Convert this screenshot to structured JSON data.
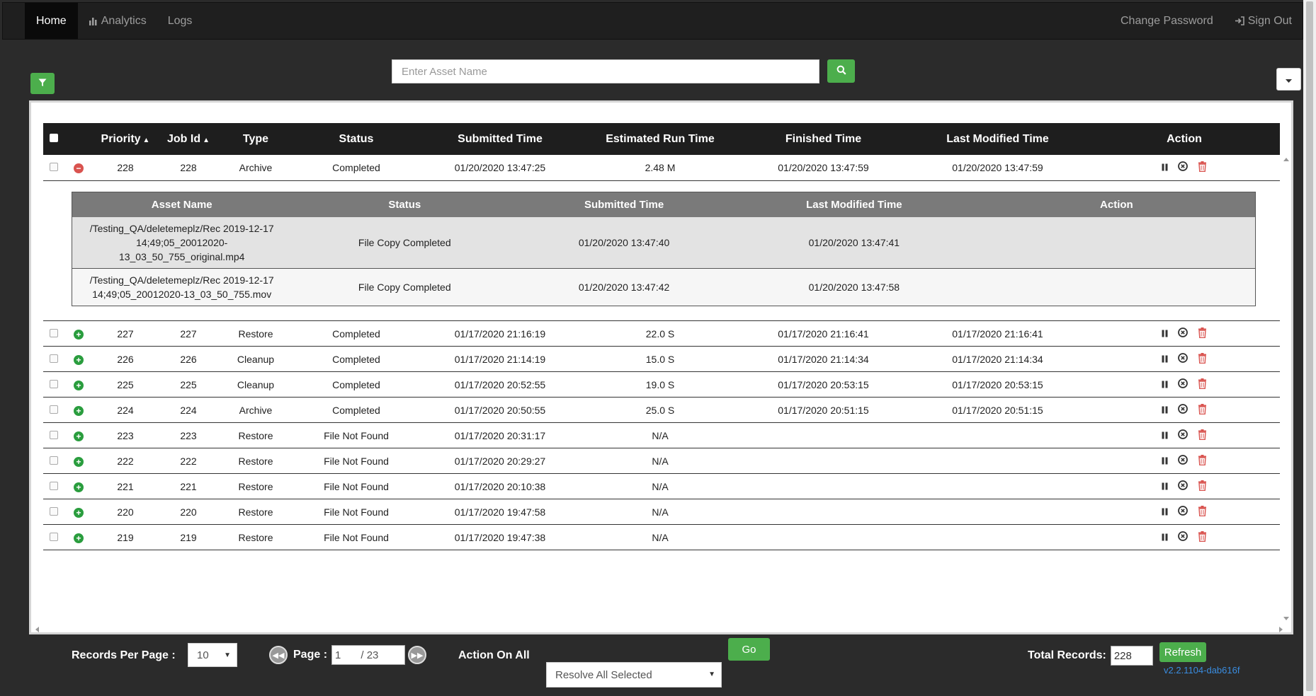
{
  "nav": {
    "home": "Home",
    "analytics": "Analytics",
    "logs": "Logs",
    "change_password": "Change Password",
    "sign_out": "Sign Out"
  },
  "search": {
    "placeholder": "Enter Asset Name"
  },
  "table": {
    "headers": {
      "priority": "Priority",
      "job_id": "Job Id",
      "type": "Type",
      "status": "Status",
      "submitted": "Submitted Time",
      "estimated": "Estimated Run Time",
      "finished": "Finished Time",
      "last_modified": "Last Modified Time",
      "action": "Action"
    },
    "rows": [
      {
        "priority": "228",
        "job_id": "228",
        "type": "Archive",
        "status": "Completed",
        "submitted": "01/20/2020 13:47:25",
        "estimated": "2.48 M",
        "finished": "01/20/2020 13:47:59",
        "last_modified": "01/20/2020 13:47:59",
        "expanded": true
      },
      {
        "priority": "227",
        "job_id": "227",
        "type": "Restore",
        "status": "Completed",
        "submitted": "01/17/2020 21:16:19",
        "estimated": "22.0 S",
        "finished": "01/17/2020 21:16:41",
        "last_modified": "01/17/2020 21:16:41"
      },
      {
        "priority": "226",
        "job_id": "226",
        "type": "Cleanup",
        "status": "Completed",
        "submitted": "01/17/2020 21:14:19",
        "estimated": "15.0 S",
        "finished": "01/17/2020 21:14:34",
        "last_modified": "01/17/2020 21:14:34"
      },
      {
        "priority": "225",
        "job_id": "225",
        "type": "Cleanup",
        "status": "Completed",
        "submitted": "01/17/2020 20:52:55",
        "estimated": "19.0 S",
        "finished": "01/17/2020 20:53:15",
        "last_modified": "01/17/2020 20:53:15"
      },
      {
        "priority": "224",
        "job_id": "224",
        "type": "Archive",
        "status": "Completed",
        "submitted": "01/17/2020 20:50:55",
        "estimated": "25.0 S",
        "finished": "01/17/2020 20:51:15",
        "last_modified": "01/17/2020 20:51:15"
      },
      {
        "priority": "223",
        "job_id": "223",
        "type": "Restore",
        "status": "File Not Found",
        "submitted": "01/17/2020 20:31:17",
        "estimated": "N/A",
        "finished": "",
        "last_modified": ""
      },
      {
        "priority": "222",
        "job_id": "222",
        "type": "Restore",
        "status": "File Not Found",
        "submitted": "01/17/2020 20:29:27",
        "estimated": "N/A",
        "finished": "",
        "last_modified": ""
      },
      {
        "priority": "221",
        "job_id": "221",
        "type": "Restore",
        "status": "File Not Found",
        "submitted": "01/17/2020 20:10:38",
        "estimated": "N/A",
        "finished": "",
        "last_modified": ""
      },
      {
        "priority": "220",
        "job_id": "220",
        "type": "Restore",
        "status": "File Not Found",
        "submitted": "01/17/2020 19:47:58",
        "estimated": "N/A",
        "finished": "",
        "last_modified": ""
      },
      {
        "priority": "219",
        "job_id": "219",
        "type": "Restore",
        "status": "File Not Found",
        "submitted": "01/17/2020 19:47:38",
        "estimated": "N/A",
        "finished": "",
        "last_modified": ""
      }
    ]
  },
  "subtable": {
    "headers": {
      "asset": "Asset Name",
      "status": "Status",
      "submitted": "Submitted Time",
      "last_modified": "Last Modified Time",
      "action": "Action"
    },
    "rows": [
      {
        "asset_lines": [
          "/Testing_QA/deletemeplz/Rec 2019-12-17",
          "14;49;05_20012020-",
          "13_03_50_755_original.mp4"
        ],
        "status": "File Copy Completed",
        "submitted": "01/20/2020 13:47:40",
        "last_modified": "01/20/2020 13:47:41"
      },
      {
        "asset_lines": [
          "/Testing_QA/deletemeplz/Rec 2019-12-17",
          "14;49;05_20012020-13_03_50_755.mov"
        ],
        "status": "File Copy Completed",
        "submitted": "01/20/2020 13:47:42",
        "last_modified": "01/20/2020 13:47:58"
      }
    ]
  },
  "footer": {
    "records_per_page_label": "Records Per Page :",
    "records_per_page_value": "10",
    "page_label": "Page :",
    "page_current": "1",
    "page_total": "/  23",
    "action_on_all_label": "Action On All",
    "action_on_all_value": "Resolve All Selected",
    "go_label": "Go",
    "total_records_label": "Total Records:",
    "total_records_value": "228",
    "refresh_label": "Refresh",
    "version": "v2.2.1104-dab616f"
  },
  "colors": {
    "accent_green": "#4cae4c",
    "delete_red": "#d9534f",
    "nav_bg": "#1f1f1f",
    "header_bg": "#1e1e1e"
  }
}
